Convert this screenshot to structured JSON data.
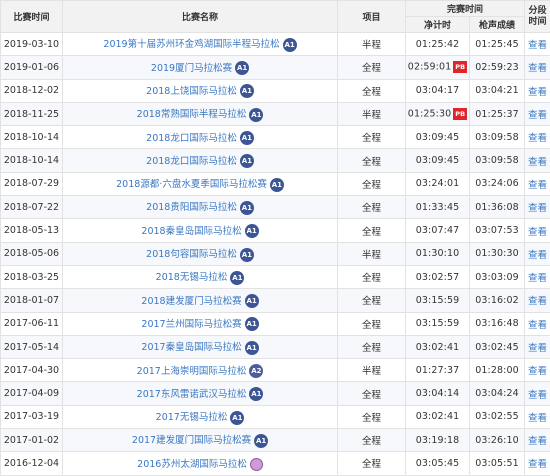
{
  "headers": {
    "date": "比赛时间",
    "race": "比赛名称",
    "event": "项目",
    "finish_group": "完赛时间",
    "net_time": "净计时",
    "gun_time": "枪声成绩",
    "splits": "分段时间"
  },
  "rows": [
    {
      "date": "2019-03-10",
      "race": "2019第十届苏州环金鸡湖国际半程马拉松",
      "badge": "A1",
      "event": "半程",
      "net": "01:25:42",
      "pb": "",
      "gun": "01:25:45",
      "view": "查看"
    },
    {
      "date": "2019-01-06",
      "race": "2019厦门马拉松赛",
      "badge": "A1",
      "event": "全程",
      "net": "02:59:01",
      "pb": "PB",
      "gun": "02:59:23",
      "view": "查看"
    },
    {
      "date": "2018-12-02",
      "race": "2018上饶国际马拉松",
      "badge": "A1",
      "event": "全程",
      "net": "03:04:17",
      "pb": "",
      "gun": "03:04:21",
      "view": "查看"
    },
    {
      "date": "2018-11-25",
      "race": "2018常熟国际半程马拉松",
      "badge": "A1",
      "event": "半程",
      "net": "01:25:30",
      "pb": "PB",
      "gun": "01:25:37",
      "view": "查看"
    },
    {
      "date": "2018-10-14",
      "race": "2018龙口国际马拉松",
      "badge": "A1",
      "event": "全程",
      "net": "03:09:45",
      "pb": "",
      "gun": "03:09:58",
      "view": "查看"
    },
    {
      "date": "2018-10-14",
      "race": "2018龙口国际马拉松",
      "badge": "A1",
      "event": "全程",
      "net": "03:09:45",
      "pb": "",
      "gun": "03:09:58",
      "view": "查看"
    },
    {
      "date": "2018-07-29",
      "race": "2018源都·六盘水夏季国际马拉松赛",
      "badge": "A1",
      "event": "全程",
      "net": "03:24:01",
      "pb": "",
      "gun": "03:24:06",
      "view": "查看"
    },
    {
      "date": "2018-07-22",
      "race": "2018贵阳国际马拉松",
      "badge": "A1",
      "event": "全程",
      "net": "01:33:45",
      "pb": "",
      "gun": "01:36:08",
      "view": "查看"
    },
    {
      "date": "2018-05-13",
      "race": "2018秦皇岛国际马拉松",
      "badge": "A1",
      "event": "全程",
      "net": "03:07:47",
      "pb": "",
      "gun": "03:07:53",
      "view": "查看"
    },
    {
      "date": "2018-05-06",
      "race": "2018句容国际马拉松",
      "badge": "A1",
      "event": "半程",
      "net": "01:30:10",
      "pb": "",
      "gun": "01:30:30",
      "view": "查看"
    },
    {
      "date": "2018-03-25",
      "race": "2018无锡马拉松",
      "badge": "A1",
      "event": "全程",
      "net": "03:02:57",
      "pb": "",
      "gun": "03:03:09",
      "view": "查看"
    },
    {
      "date": "2018-01-07",
      "race": "2018建发厦门马拉松赛",
      "badge": "A1",
      "event": "全程",
      "net": "03:15:59",
      "pb": "",
      "gun": "03:16:02",
      "view": "查看"
    },
    {
      "date": "2017-06-11",
      "race": "2017兰州国际马拉松赛",
      "badge": "A1",
      "event": "全程",
      "net": "03:15:59",
      "pb": "",
      "gun": "03:16:48",
      "view": "查看"
    },
    {
      "date": "2017-05-14",
      "race": "2017秦皇岛国际马拉松",
      "badge": "A1",
      "event": "全程",
      "net": "03:02:41",
      "pb": "",
      "gun": "03:02:45",
      "view": "查看"
    },
    {
      "date": "2017-04-30",
      "race": "2017上海崇明国际马拉松",
      "badge": "A2",
      "event": "半程",
      "net": "01:27:37",
      "pb": "",
      "gun": "01:28:00",
      "view": "查看"
    },
    {
      "date": "2017-04-09",
      "race": "2017东风雷诺武汉马拉松",
      "badge": "A1",
      "event": "全程",
      "net": "03:04:14",
      "pb": "",
      "gun": "03:04:24",
      "view": "查看"
    },
    {
      "date": "2017-03-19",
      "race": "2017无锡马拉松",
      "badge": "A1",
      "event": "全程",
      "net": "03:02:41",
      "pb": "",
      "gun": "03:02:55",
      "view": "查看"
    },
    {
      "date": "2017-01-02",
      "race": "2017建发厦门国际马拉松赛",
      "badge": "A1",
      "event": "全程",
      "net": "03:19:18",
      "pb": "",
      "gun": "03:26:10",
      "view": "查看"
    },
    {
      "date": "2016-12-04",
      "race": "2016苏州太湖国际马拉松",
      "badge": "",
      "event": "全程",
      "net": "03:05:45",
      "pb": "",
      "gun": "03:05:51",
      "view": "查看"
    }
  ],
  "colors": {
    "link": "#3a78c4",
    "badge": "#3c5594",
    "pb": "#e0262a",
    "header_bg": "#f2f2f2"
  }
}
